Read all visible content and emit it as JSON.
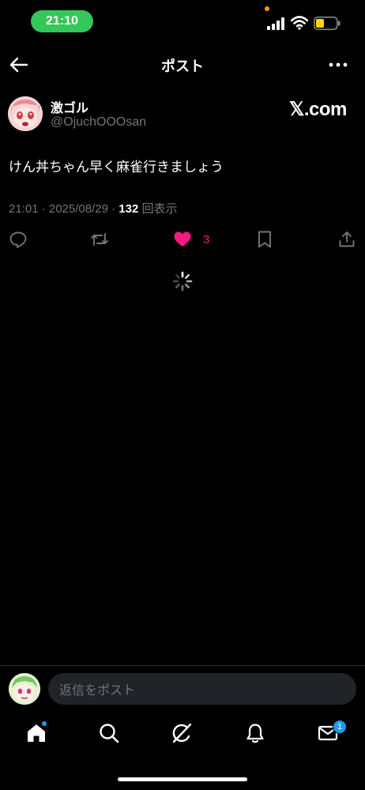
{
  "status_bar": {
    "time": "21:10"
  },
  "header": {
    "title": "ポスト"
  },
  "post": {
    "display_name": "激ゴル",
    "handle": "@OjuchOOOsan",
    "watermark": "𝕏.com",
    "text": "けん丼ちゃん早く麻雀行きましょう",
    "timestamp": "21:01 · 2025/08/29 · ",
    "views_count": "132",
    "views_label": " 回表示",
    "like_count": "3"
  },
  "reply": {
    "placeholder": "返信をポスト"
  },
  "nav": {
    "mail_badge": "1"
  },
  "colors": {
    "accent": "#1d9bf0",
    "like": "#f91880",
    "time_pill": "#34c759",
    "battery": "#ffd60a"
  },
  "icons": [
    "back-arrow-icon",
    "more-icon",
    "reply-icon",
    "retweet-icon",
    "heart-icon",
    "bookmark-icon",
    "share-icon",
    "home-icon",
    "search-icon",
    "grok-icon",
    "bell-icon",
    "mail-icon"
  ]
}
